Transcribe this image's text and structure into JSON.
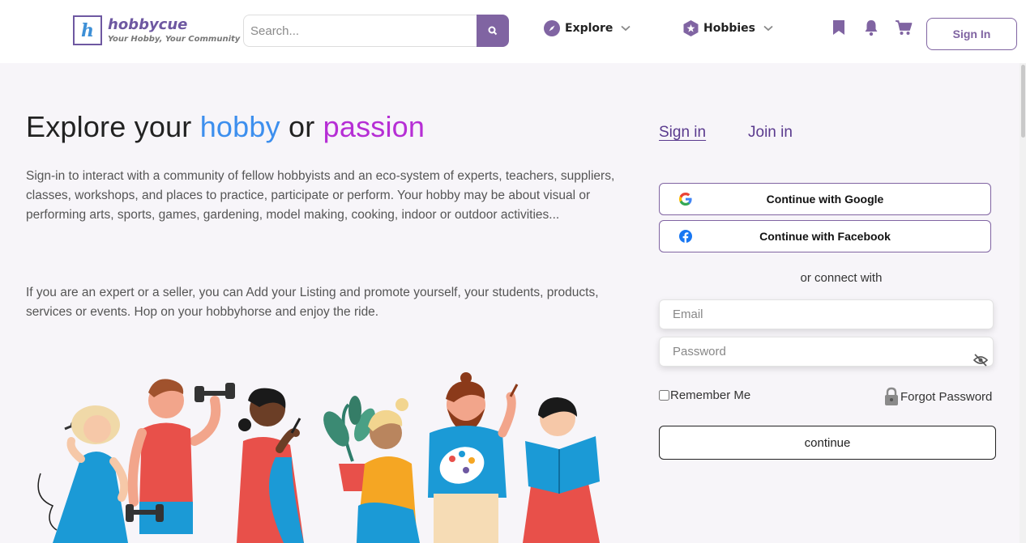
{
  "brand": {
    "logo_letter": "h",
    "name": "hobbycue",
    "tagline": "Your Hobby, Your Community"
  },
  "header": {
    "search_placeholder": "Search...",
    "search_icon": "magnifier-icon",
    "explore_label": "Explore",
    "hobbies_label": "Hobbies",
    "signin_label": "Sign In",
    "icons": [
      "compass-icon",
      "chevron-down-icon",
      "hexagon-star-icon",
      "bookmark-icon",
      "bell-icon",
      "cart-icon"
    ]
  },
  "hero": {
    "title_part1": "Explore your ",
    "title_hobby": "hobby",
    "title_or": " or ",
    "title_passion": "passion",
    "paragraph1": "Sign-in to interact with a community of fellow hobbyists and an eco-system of experts, teachers, suppliers, classes, workshops, and places to practice, participate or perform. Your hobby may be about visual or performing arts, sports, games, gardening, model making, cooking, indoor or outdoor activities...",
    "paragraph2": "If you are an expert or a seller, you can Add your Listing and promote yourself, your students, products, services or events. Hop on your hobbyhorse and enjoy the ride."
  },
  "auth": {
    "tab_signin": "Sign in",
    "tab_join": "Join in",
    "google_label": "Continue with Google",
    "facebook_label": "Continue with Facebook",
    "or_text": "or connect with",
    "email_placeholder": "Email",
    "password_placeholder": "Password",
    "remember_label": "Remember Me",
    "forgot_label": "Forgot Password",
    "continue_label": "continue"
  },
  "colors": {
    "brand_purple": "#8064a2",
    "hobby_blue": "#3d8fee",
    "passion_purple": "#b62ed5",
    "tab_purple": "#5a3a8e",
    "page_bg": "#f7f5f9"
  }
}
